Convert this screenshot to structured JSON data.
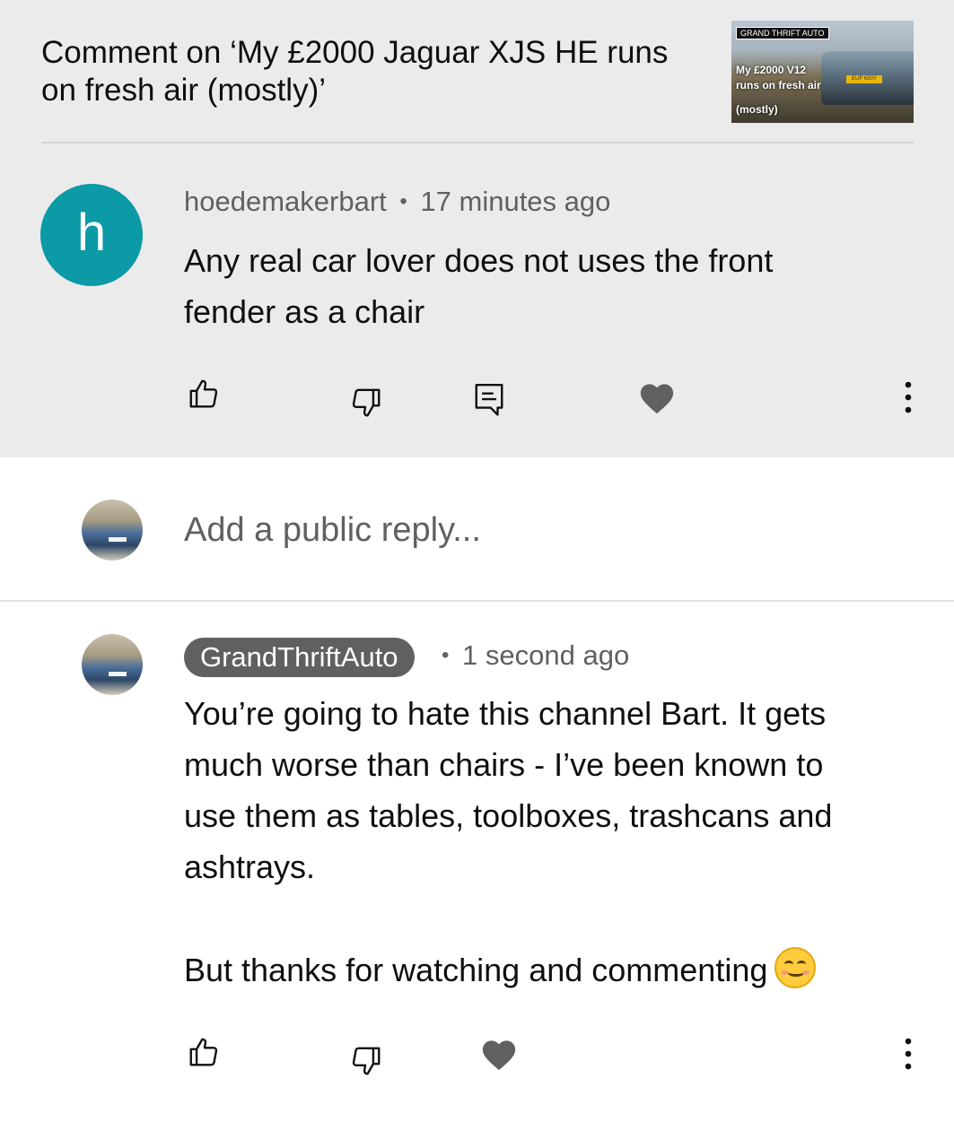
{
  "header": {
    "title": "Comment on ‘My £2000 Jaguar XJS HE runs on fresh air (mostly)’",
    "thumbnail": {
      "brand": "GRAND THRIFT AUTO",
      "line1": "My £2000 V12",
      "line2": "runs on fresh air",
      "line3": "(mostly)",
      "plate": "EUP 630Y"
    }
  },
  "comment": {
    "avatar_letter": "h",
    "author": "hoedemakerbart",
    "separator": "•",
    "time": "17 minutes ago",
    "text_line1": "Any real car lover does not uses the front",
    "text_line2": "fender as a chair",
    "avatar_color": "#0c9aa6"
  },
  "reply_box": {
    "placeholder": "Add a public reply..."
  },
  "reply": {
    "author": "GrandThriftAuto",
    "separator": "•",
    "time": "1 second ago",
    "lines": [
      "You’re going to hate this channel Bart. It gets",
      "much worse than chairs - I’ve been known to",
      "use them as tables, toolboxes, trashcans and",
      "ashtrays."
    ],
    "closing": "But thanks for watching and commenting",
    "emoji": "smiling-face-emoji"
  },
  "icons": {
    "like": "thumbs-up-icon",
    "dislike": "thumbs-down-icon",
    "reply": "reply-icon",
    "heart": "heart-icon",
    "more": "more-vertical-icon"
  }
}
